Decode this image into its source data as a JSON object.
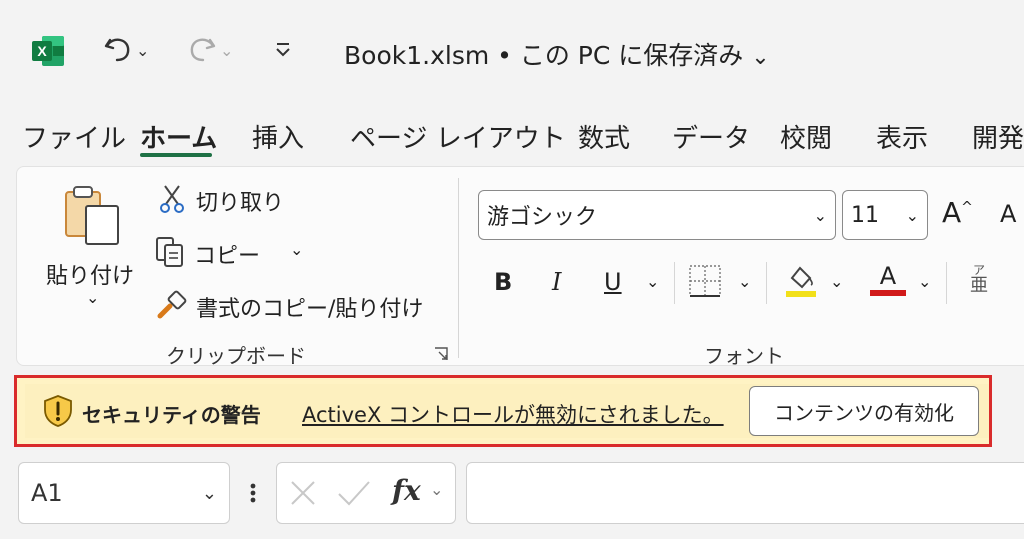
{
  "titlebar": {
    "document_title": "Book1.xlsm • この PC に保存済み",
    "undo_icon": "undo-icon",
    "redo_icon": "redo-icon"
  },
  "tabs": [
    {
      "label": "ファイル"
    },
    {
      "label": "ホーム",
      "active": true
    },
    {
      "label": "挿入"
    },
    {
      "label": "ページ レイアウト"
    },
    {
      "label": "数式"
    },
    {
      "label": "データ"
    },
    {
      "label": "校閲"
    },
    {
      "label": "表示"
    },
    {
      "label": "開発"
    }
  ],
  "clipboard": {
    "paste_label": "貼り付け",
    "cut_label": "切り取り",
    "copy_label": "コピー",
    "format_painter_label": "書式のコピー/貼り付け",
    "group_label": "クリップボード"
  },
  "font": {
    "font_name": "游ゴシック",
    "font_size": "11",
    "bold": "B",
    "italic": "I",
    "underline": "U",
    "font_color_letter": "A",
    "grow_font": "A",
    "shrink_font": "A",
    "phonetic_top": "ア",
    "phonetic_bottom": "亜",
    "group_label": "フォント",
    "highlight_color": "#f2e01a",
    "font_color": "#d11a1a"
  },
  "security_bar": {
    "title": "セキュリティの警告",
    "message": "ActiveX コントロールが無効にされました。",
    "button_label": "コンテンツの有効化",
    "border_color": "#d92b2b",
    "background": "#fdf0bf"
  },
  "formula_bar": {
    "name_box_value": "A1",
    "fx_label": "fx",
    "formula_value": ""
  },
  "colors": {
    "accent": "#1e7145",
    "excel_green": "#107c41"
  }
}
